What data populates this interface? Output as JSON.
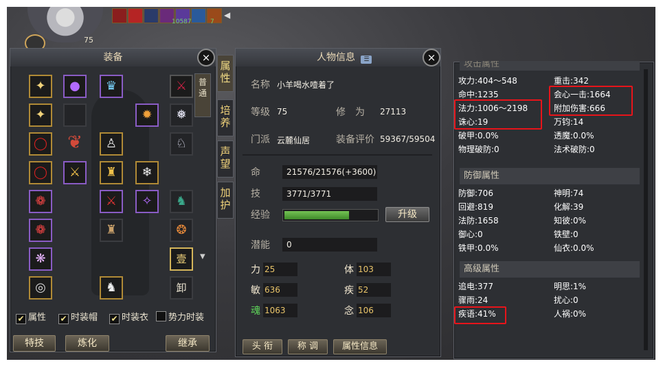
{
  "hud": {
    "level": "75",
    "buff_numbers": [
      "10587",
      "7"
    ]
  },
  "equipment": {
    "title": "装备",
    "side_tab": "普通",
    "checkboxes": [
      {
        "label": "属性",
        "checked": true
      },
      {
        "label": "时装帽",
        "checked": true
      },
      {
        "label": "时装衣",
        "checked": true
      },
      {
        "label": "势力时装",
        "checked": false
      }
    ],
    "buttons": [
      "特技",
      "炼化",
      "继承"
    ],
    "slot_glyphs": [
      "壹",
      "卸"
    ]
  },
  "tabs": [
    "属性",
    "培养",
    "声望",
    "加护"
  ],
  "character": {
    "title": "人物信息",
    "name_label": "名称",
    "name": "小羊喝水噎着了",
    "level_label": "等级",
    "level": "75",
    "cultivation_label": "修　为",
    "cultivation": "27113",
    "sect_label": "门派",
    "sect": "云麓仙居",
    "gear_score_label": "装备评价",
    "gear_score": "59367/59504",
    "hp_label": "命",
    "hp": "21576/21576(+3600)",
    "skill_label": "技",
    "skill": "3771/3771",
    "exp_label": "经验",
    "exp_progress": 0.7,
    "upgrade_button": "升级",
    "potential_label": "潜能",
    "potential": "0",
    "attributes": [
      {
        "label": "力",
        "value": "25"
      },
      {
        "label": "体",
        "value": "103"
      },
      {
        "label": "敏",
        "value": "636"
      },
      {
        "label": "疾",
        "value": "52"
      },
      {
        "label": "魂",
        "value": "1063"
      },
      {
        "label": "念",
        "value": "106"
      }
    ],
    "bottom_buttons": [
      "头 衔",
      "称 调",
      "属性信息"
    ]
  },
  "stats": {
    "top_header": "攻击属性",
    "attack": [
      [
        "攻力:404～548",
        "重击:342"
      ],
      [
        "命中:1235",
        "会心一击:1664"
      ],
      [
        "法力:1006～2198",
        "附加伤害:666"
      ],
      [
        "诛心:19",
        "万钧:14"
      ],
      [
        "破甲:0.0%",
        "透魔:0.0%"
      ],
      [
        "物理破防:0",
        "法术破防:0"
      ]
    ],
    "defense_header": "防御属性",
    "defense": [
      [
        "防御:706",
        "神明:74"
      ],
      [
        "回避:819",
        "化解:39"
      ],
      [
        "法防:1658",
        "知彼:0%"
      ],
      [
        "御心:0",
        "铁壁:0"
      ],
      [
        "铁甲:0.0%",
        "仙衣:0.0%"
      ]
    ],
    "advanced_header": "高级属性",
    "advanced": [
      [
        "追电:377",
        "明思:1%"
      ],
      [
        "骤雨:24",
        "扰心:0"
      ],
      [
        "疾语:41%",
        "人祸:0%"
      ]
    ]
  }
}
